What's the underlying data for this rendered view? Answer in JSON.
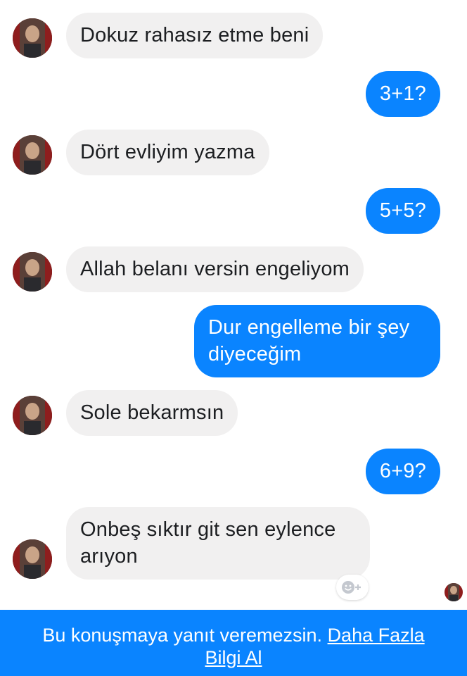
{
  "messages": [
    {
      "side": "in",
      "text": "Dokuz rahasız etme beni"
    },
    {
      "side": "out",
      "text": "3+1?"
    },
    {
      "side": "in",
      "text": "Dört evliyim yazma"
    },
    {
      "side": "out",
      "text": "5+5?"
    },
    {
      "side": "in",
      "text": "Allah belanı versin engeliyom"
    },
    {
      "side": "out",
      "text": "Dur engelleme bir şey\ndiyeceğim"
    },
    {
      "side": "in",
      "text": "Sole bekarmsın"
    },
    {
      "side": "out",
      "text": "6+9?"
    },
    {
      "side": "in",
      "text": "Onbeş sıktır git sen eylence\narıyon"
    }
  ],
  "footer": {
    "notice": "Bu konuşmaya yanıt veremezsin.",
    "link_line1": "Daha Fazla",
    "link_line2": "Bilgi Al"
  },
  "colors": {
    "outgoing_bubble": "#0a84ff",
    "incoming_bubble": "#f1f0f0",
    "footer_bg": "#0a84ff"
  },
  "icons": {
    "avatar": "contact-avatar-icon",
    "reaction": "add-reaction-icon",
    "seen": "seen-avatar-icon"
  }
}
